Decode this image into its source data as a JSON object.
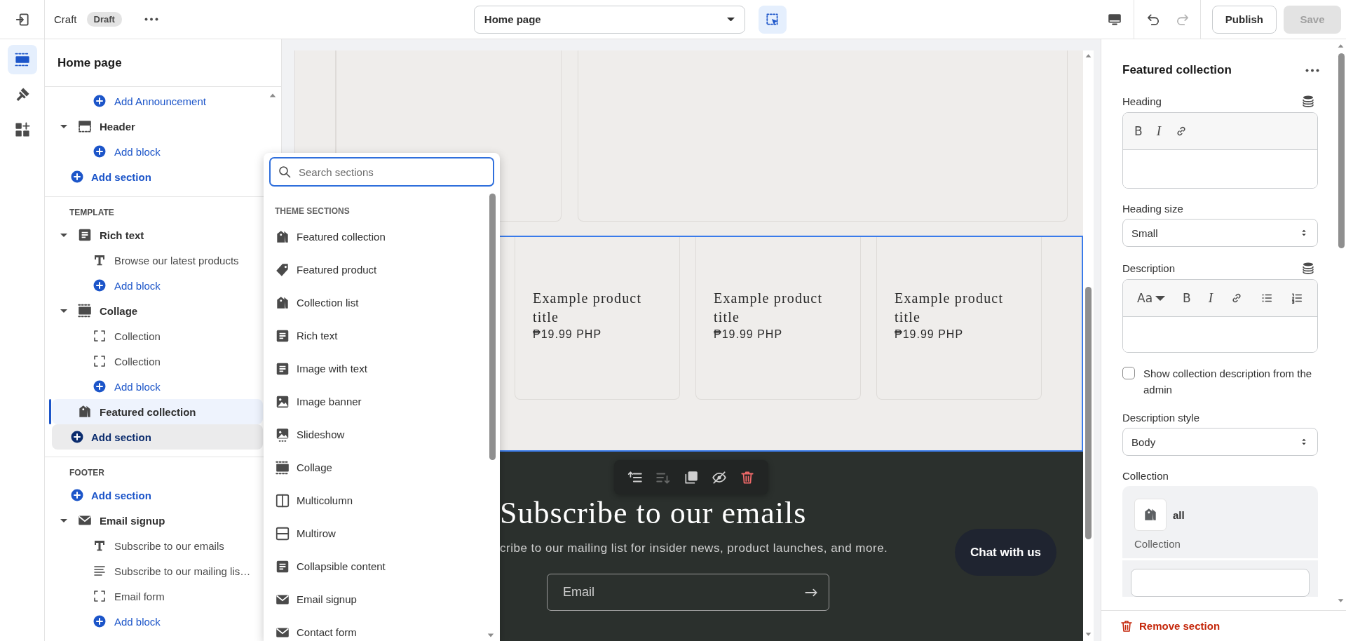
{
  "topbar": {
    "theme": "Craft",
    "badge": "Draft",
    "page": "Home page",
    "publish": "Publish",
    "save": {
      "label": "Save",
      "disabled": true
    }
  },
  "rail": [
    {
      "kind": "sections",
      "selected": true
    },
    {
      "kind": "theme-settings",
      "selected": false
    },
    {
      "kind": "apps",
      "selected": false
    }
  ],
  "sidebar": {
    "title": "Home page",
    "groups": [
      {
        "items": [
          {
            "kind": "add-block",
            "label": "Add Announcement"
          },
          {
            "kind": "header",
            "label": "Header",
            "selected": false,
            "children": [
              {
                "kind": "add-block",
                "label": "Add block"
              }
            ]
          },
          {
            "kind": "add-section",
            "label": "Add section",
            "hovered": false
          }
        ]
      },
      {
        "heading": "TEMPLATE",
        "items": [
          {
            "kind": "text",
            "label": "Rich text",
            "selected": false,
            "children": [
              {
                "kind": "heading",
                "label": "Browse our latest products"
              },
              {
                "kind": "add-block",
                "label": "Add block"
              }
            ]
          },
          {
            "kind": "collage",
            "label": "Collage",
            "selected": false,
            "children": [
              {
                "kind": "frame",
                "label": "Collection"
              },
              {
                "kind": "frame",
                "label": "Collection"
              },
              {
                "kind": "add-block",
                "label": "Add block"
              }
            ]
          },
          {
            "kind": "collection",
            "label": "Featured collection",
            "selected": true
          },
          {
            "kind": "add-section",
            "label": "Add section",
            "hovered": true
          }
        ]
      },
      {
        "heading": "FOOTER",
        "items": [
          {
            "kind": "add-section",
            "label": "Add section",
            "hovered": false
          },
          {
            "kind": "email",
            "label": "Email signup",
            "selected": false,
            "children": [
              {
                "kind": "heading",
                "label": "Subscribe to our emails"
              },
              {
                "kind": "paragraph",
                "label": "Subscribe to our mailing lis…"
              },
              {
                "kind": "frame",
                "label": "Email form"
              },
              {
                "kind": "add-block",
                "label": "Add block"
              }
            ]
          }
        ]
      }
    ]
  },
  "picker": {
    "placeholder": "Search sections",
    "heading": "THEME SECTIONS",
    "items": [
      {
        "label": "Featured collection",
        "kind": "collection"
      },
      {
        "label": "Featured product",
        "kind": "product"
      },
      {
        "label": "Collection list",
        "kind": "collection"
      },
      {
        "label": "Rich text",
        "kind": "text"
      },
      {
        "label": "Image with text",
        "kind": "text"
      },
      {
        "label": "Image banner",
        "kind": "image"
      },
      {
        "label": "Slideshow",
        "kind": "slideshow"
      },
      {
        "label": "Collage",
        "kind": "collage"
      },
      {
        "label": "Multicolumn",
        "kind": "multicolumn"
      },
      {
        "label": "Multirow",
        "kind": "multirow"
      },
      {
        "label": "Collapsible content",
        "kind": "text"
      },
      {
        "label": "Email signup",
        "kind": "email"
      },
      {
        "label": "Contact form",
        "kind": "email"
      }
    ]
  },
  "preview": {
    "products": [
      {
        "title": "Example product title",
        "price": "₱19.99 PHP"
      },
      {
        "title": "Example product title",
        "price": "₱19.99 PHP"
      },
      {
        "title": "Example product title",
        "price": "₱19.99 PHP"
      }
    ],
    "toolbar": [
      {
        "kind": "move-up",
        "disabled": false
      },
      {
        "kind": "move-down",
        "disabled": true
      },
      {
        "kind": "duplicate",
        "disabled": false
      },
      {
        "kind": "hide",
        "disabled": false
      },
      {
        "kind": "remove",
        "disabled": false
      }
    ],
    "newsletter": {
      "heading": "Subscribe to our emails",
      "text": "cribe to our mailing list for insider news, product launches, and more.",
      "email_placeholder": "Email"
    },
    "chat_button": "Chat with us"
  },
  "settings": {
    "title": "Featured collection",
    "fields": [
      {
        "kind": "richtext",
        "label": "Heading",
        "tools": [
          "B",
          "I"
        ],
        "extended": false
      },
      {
        "kind": "select",
        "label": "Heading size",
        "value": "Small"
      },
      {
        "kind": "richtext",
        "label": "Description",
        "font_menu": "Aa",
        "tools": [
          "B",
          "I"
        ],
        "extended": true
      },
      {
        "kind": "checkbox",
        "label": "Show collection description from the admin",
        "checked": false
      },
      {
        "kind": "select",
        "label": "Description style",
        "value": "Body"
      },
      {
        "kind": "collection",
        "label": "Collection",
        "name": "all",
        "subtitle": "Collection"
      }
    ],
    "remove": "Remove section"
  }
}
